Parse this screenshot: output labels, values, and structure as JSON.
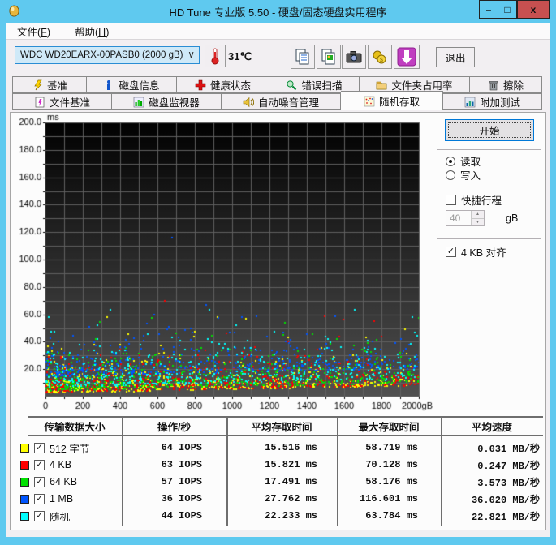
{
  "window": {
    "title": "HD Tune 专业版 5.50 - 硬盘/固态硬盘实用程序",
    "controls": {
      "minimize": "–",
      "maximize": "□",
      "close": "x"
    }
  },
  "menu": {
    "items": [
      {
        "pre": "文件(",
        "key": "F",
        "post": ")"
      },
      {
        "pre": "帮助(",
        "key": "H",
        "post": ")"
      }
    ]
  },
  "toolbar": {
    "drive_select": {
      "value": "WDC WD20EARX-00PASB0 (2000 gB)"
    },
    "temperature": "31℃",
    "icons": [
      "thermometer-icon",
      "copy-text-icon",
      "copy-image-icon",
      "camera-icon",
      "coins-icon",
      "update-download-icon"
    ],
    "exit_label": "退出"
  },
  "tabs": {
    "row1": [
      {
        "label": "基准",
        "icon": "benchmark-icon"
      },
      {
        "label": "磁盘信息",
        "icon": "disk-info-icon"
      },
      {
        "label": "健康状态",
        "icon": "health-icon"
      },
      {
        "label": "错误扫描",
        "icon": "error-scan-icon"
      },
      {
        "label": "文件夹占用率",
        "icon": "folder-usage-icon"
      },
      {
        "label": "擦除",
        "icon": "erase-icon"
      }
    ],
    "row2": [
      {
        "label": "文件基准",
        "icon": "file-benchmark-icon"
      },
      {
        "label": "磁盘监视器",
        "icon": "disk-monitor-icon"
      },
      {
        "label": "自动噪音管理",
        "icon": "aam-icon"
      },
      {
        "label": "随机存取",
        "icon": "random-access-icon"
      },
      {
        "label": "附加测试",
        "icon": "extra-tests-icon"
      }
    ],
    "active": "随机存取"
  },
  "controls": {
    "start_label": "开始",
    "read_label": "读取",
    "write_label": "写入",
    "read_selected": true,
    "short_stroke_label": "快捷行程",
    "short_stroke_checked": false,
    "short_stroke_value": "40",
    "short_stroke_unit": "gB",
    "align_label": "4 KB 对齐",
    "align_checked": true,
    "check_glyph": "✓",
    "spin_up_glyph": "▲",
    "spin_down_glyph": "▼",
    "chevron_glyph": "∨"
  },
  "chart_data": {
    "type": "scatter",
    "x_unit": "gB",
    "y_unit": "ms",
    "xlim": [
      0,
      2000
    ],
    "ylim": [
      0,
      200
    ],
    "x_tick_step": 200,
    "x_minor_step": 100,
    "y_tick_step": 20,
    "y_minor_step": 10,
    "grid": true,
    "bg_top": "#020202",
    "bg_bottom": "#515151",
    "grid_color": "#606060",
    "seed": 1337,
    "density_skew": 1.3,
    "series": [
      {
        "name": "512 字节",
        "color": "#ffff00",
        "count": 560,
        "y_base": 3.2,
        "y_slope": 5.0,
        "y_spread": 7.5,
        "y_max": 58.719
      },
      {
        "name": "4 KB",
        "color": "#ff0000",
        "count": 540,
        "y_base": 3.6,
        "y_slope": 5.0,
        "y_spread": 8.0,
        "y_max": 70.128
      },
      {
        "name": "64 KB",
        "color": "#00e000",
        "count": 520,
        "y_base": 4.8,
        "y_slope": 5.5,
        "y_spread": 8.5,
        "y_max": 58.176
      },
      {
        "name": "1 MB",
        "color": "#0055ff",
        "count": 440,
        "y_base": 15.0,
        "y_slope": 6.0,
        "y_spread": 8.5,
        "y_max": 116.601
      },
      {
        "name": "随机",
        "color": "#00ffff",
        "count": 480,
        "y_base": 7.5,
        "y_slope": 5.5,
        "y_spread": 10.0,
        "y_max": 63.784
      }
    ]
  },
  "table": {
    "headers": [
      "传输数据大小",
      "操作/秒",
      "平均存取时间",
      "最大存取时间",
      "平均速度"
    ],
    "rows": [
      {
        "color": "#ffff00",
        "checked": true,
        "label": "512 字节",
        "iops": "64 IOPS",
        "avg": "15.516 ms",
        "max": "58.719 ms",
        "speed": "0.031 MB/秒"
      },
      {
        "color": "#ff0000",
        "checked": true,
        "label": "4 KB",
        "iops": "63 IOPS",
        "avg": "15.821 ms",
        "max": "70.128 ms",
        "speed": "0.247 MB/秒"
      },
      {
        "color": "#00e000",
        "checked": true,
        "label": "64 KB",
        "iops": "57 IOPS",
        "avg": "17.491 ms",
        "max": "58.176 ms",
        "speed": "3.573 MB/秒"
      },
      {
        "color": "#0055ff",
        "checked": true,
        "label": "1 MB",
        "iops": "36 IOPS",
        "avg": "27.762 ms",
        "max": "116.601 ms",
        "speed": "36.020 MB/秒"
      },
      {
        "color": "#00ffff",
        "checked": true,
        "label": "随机",
        "iops": "44 IOPS",
        "avg": "22.233 ms",
        "max": "63.784 ms",
        "speed": "22.821 MB/秒"
      }
    ]
  }
}
